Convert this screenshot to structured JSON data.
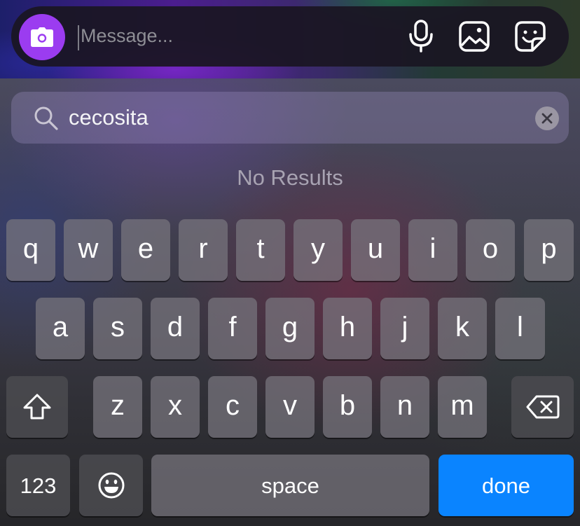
{
  "message_bar": {
    "placeholder": "Message...",
    "camera_icon": "camera-icon",
    "mic_icon": "microphone-icon",
    "gallery_icon": "image-icon",
    "sticker_icon": "sticker-icon",
    "accent": "#9b3cf0"
  },
  "search": {
    "query": "cecosita",
    "icon": "search-icon",
    "clear_icon": "clear-icon"
  },
  "status": {
    "text": "No Results"
  },
  "keyboard": {
    "row1": [
      "q",
      "w",
      "e",
      "r",
      "t",
      "y",
      "u",
      "i",
      "o",
      "p"
    ],
    "row2": [
      "a",
      "s",
      "d",
      "f",
      "g",
      "h",
      "j",
      "k",
      "l"
    ],
    "row3": [
      "z",
      "x",
      "c",
      "v",
      "b",
      "n",
      "m"
    ],
    "shift_icon": "shift-icon",
    "backspace_icon": "backspace-icon",
    "numbers_label": "123",
    "emoji_icon": "emoji-icon",
    "space_label": "space",
    "done_label": "done",
    "done_color": "#0a84ff"
  }
}
